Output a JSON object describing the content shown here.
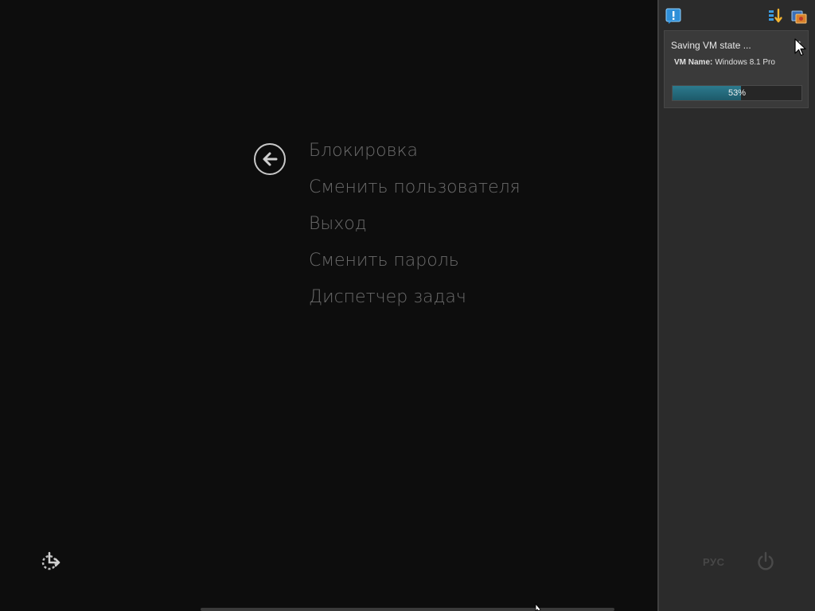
{
  "sas_menu": {
    "items": [
      {
        "label": "Блокировка"
      },
      {
        "label": "Сменить пользователя"
      },
      {
        "label": "Выход"
      },
      {
        "label": "Сменить пароль"
      },
      {
        "label": "Диспетчер задач"
      }
    ],
    "back_icon": "back-arrow-icon",
    "accessibility_icon": "ease-of-access-icon"
  },
  "vm_panel": {
    "top_icons": [
      "notification-icon",
      "sort-icon",
      "vm-manager-icon"
    ],
    "notification": {
      "title": "Saving VM state ...",
      "close_icon": "close-icon",
      "vm_name_label": "VM Name:",
      "vm_name_value": "Windows 8.1 Pro",
      "progress_percent": 53,
      "progress_text": "53%"
    },
    "language": "РУС",
    "power_icon": "power-icon"
  },
  "colors": {
    "background": "#0d0d0d",
    "menu_text": "#6b6b6b",
    "panel_bg": "#2b2b2b",
    "progress_fill": "#2c7a8e"
  }
}
